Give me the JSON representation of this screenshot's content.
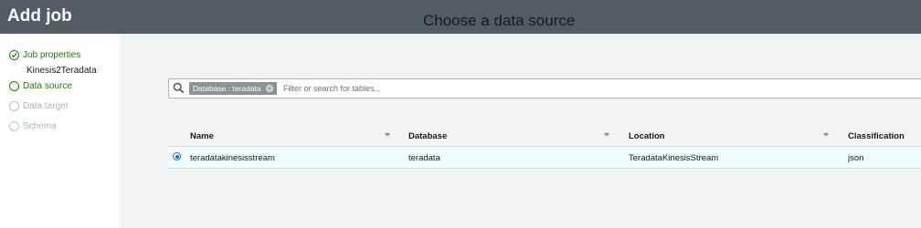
{
  "header": {
    "title": "Add job"
  },
  "sidebar": {
    "steps": [
      {
        "label": "Job properties",
        "state": "done"
      },
      {
        "label": "Data source",
        "state": "active"
      },
      {
        "label": "Data target",
        "state": "disabled"
      },
      {
        "label": "Schema",
        "state": "disabled"
      }
    ],
    "job_name": "Kinesis2Teradata"
  },
  "main": {
    "heading": "Choose a data source",
    "search": {
      "token": "Database : teradata",
      "placeholder": "Filter or search for tables..."
    },
    "table": {
      "columns": [
        "Name",
        "Database",
        "Location",
        "Classification"
      ],
      "rows": [
        {
          "selected": true,
          "name": "teradatakinesisstream",
          "database": "teradata",
          "location": "TeradataKinesisStream",
          "classification": "json"
        }
      ]
    }
  },
  "colors": {
    "topbar": "#545b64",
    "success": "#1d8102",
    "selection": "#0073bb"
  }
}
